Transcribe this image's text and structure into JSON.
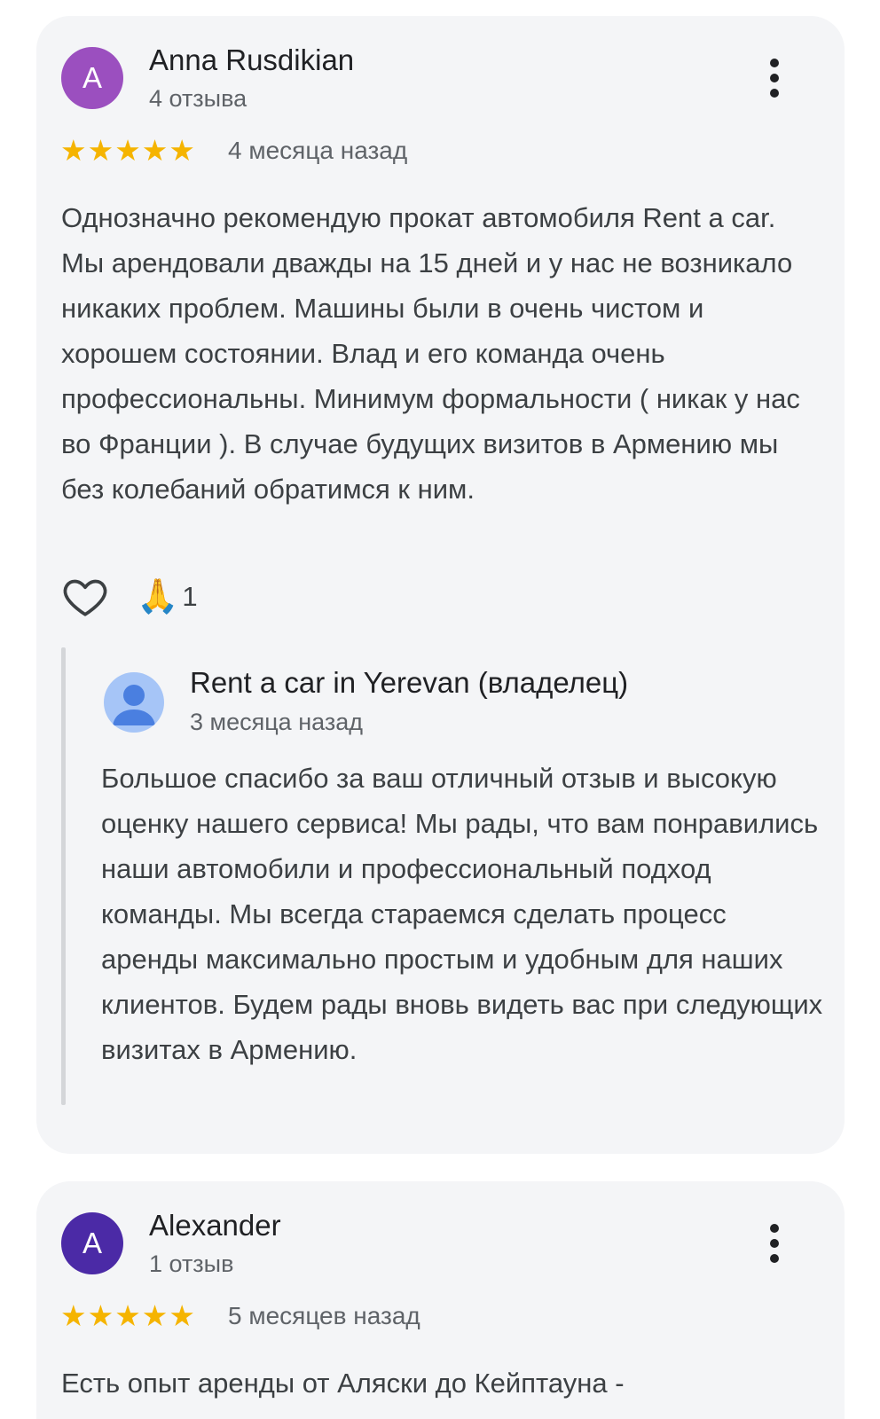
{
  "reviews": [
    {
      "avatar_letter": "A",
      "avatar_color": "#9b4fbf",
      "name": "Anna Rusdikian",
      "count": "4 отзыва",
      "stars": 5,
      "date": "4 месяца назад",
      "text": "Однозначно рекомендую прокат автомобиля Rent a car. Мы арендовали дважды на 15 дней и у нас не возникало никаких проблем. Машины были в очень чистом и хорошем состоянии. Влад и его команда очень профессиональны. Минимум формальности ( никак у нас во Франции ). В случае будущих визитов в Армению мы без колебаний обратимся к ним.",
      "reaction_icon": "🙏",
      "reaction_count": "1",
      "reply": {
        "owner": "Rent a car in Yerevan (владелец)",
        "date": "3 месяца назад",
        "text": "Большое спасибо за ваш отличный отзыв и высокую оценку нашего сервиса! Мы рады, что вам понравились наши автомобили и профессиональный подход команды. Мы всегда стараемся сделать процесс аренды максимально простым и удобным для наших клиентов. Будем рады вновь видеть вас при следующих визитах в Армению."
      }
    },
    {
      "avatar_letter": "A",
      "avatar_color": "#4b2aa6",
      "name": "Alexander",
      "count": "1 отзыв",
      "stars": 5,
      "date": "5 месяцев назад",
      "text": "Есть опыт аренды от Аляски до Кейптауна -"
    }
  ],
  "colors": {
    "star": "#f5b400",
    "card_bg": "#f4f5f7",
    "owner_avatar_bg": "#a6c5f7",
    "owner_avatar_fg": "#4a7fe0"
  },
  "icons": {
    "more": "more-vert-icon",
    "star": "star-icon",
    "like": "heart-outline-icon",
    "owner": "person-icon"
  },
  "star_glyph": "★"
}
